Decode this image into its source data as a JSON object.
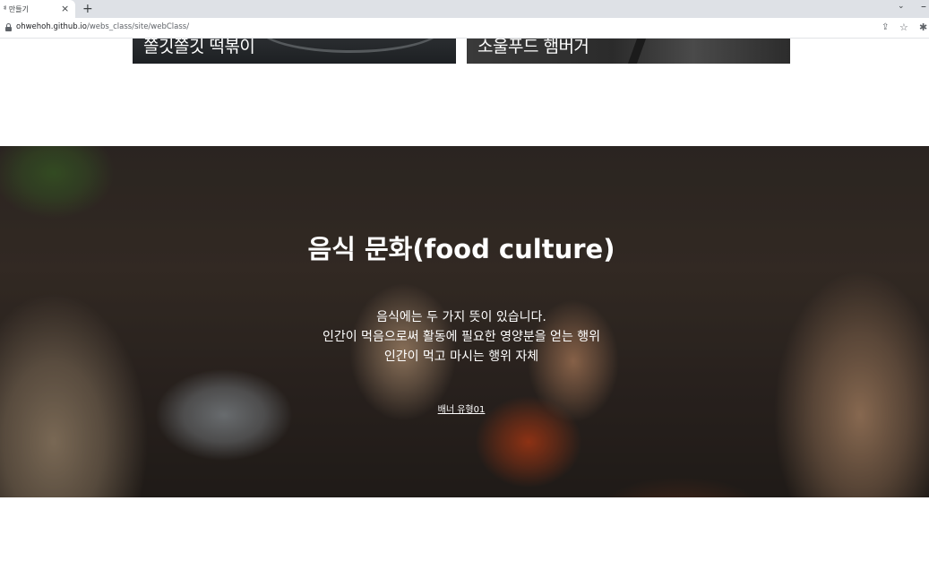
{
  "browser": {
    "tab_title": "ᅨ 만들기",
    "tab_close": "×",
    "new_tab": "+",
    "chevron": "⌄",
    "minimize": "–",
    "url_host": "ohwehoh.github.io",
    "url_path": "/webs_class/site/webClass/",
    "icons": [
      "lock-icon",
      "share-icon",
      "star-icon",
      "extensions-icon"
    ]
  },
  "cards": [
    {
      "title": "쫄깃쫄깃 떡볶이"
    },
    {
      "title": "소울푸드 햄버거"
    }
  ],
  "banner": {
    "title": "음식 문화(food culture)",
    "lines": [
      "음식에는 두 가지 뜻이 있습니다.",
      "인간이 먹음으로써 활동에 필요한 영양분을 얻는 행위",
      "인간이 먹고 마시는 행위 자체"
    ],
    "link_label": "배너 유형01"
  },
  "colors": {
    "tabbar": "#dee1e6",
    "text_dark": "#202124",
    "banner_text": "#ffffff"
  }
}
